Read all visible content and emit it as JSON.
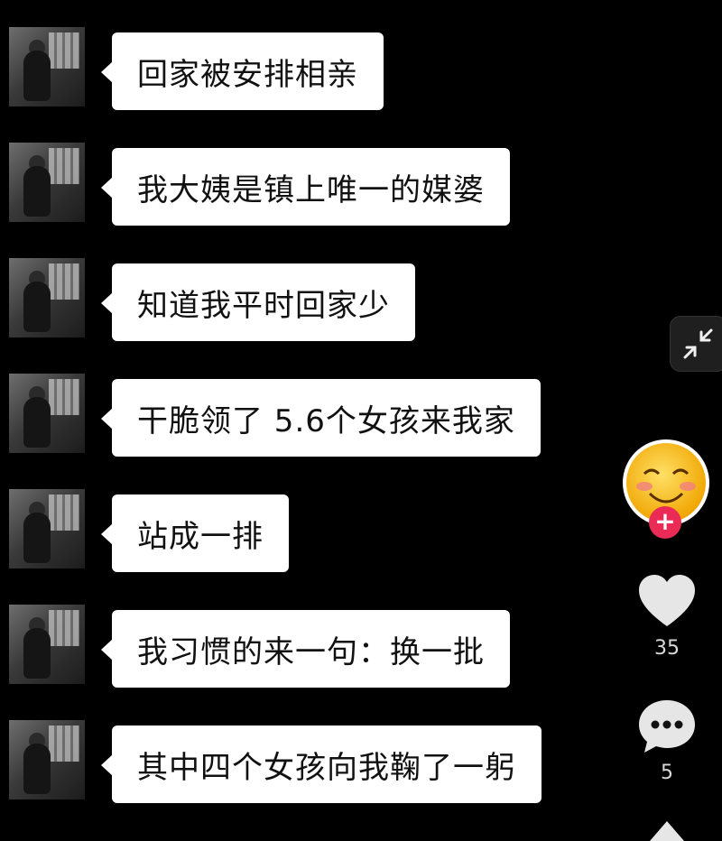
{
  "messages": [
    {
      "text": "回家被安排相亲"
    },
    {
      "text": "我大姨是镇上唯一的媒婆"
    },
    {
      "text": "知道我平时回家少"
    },
    {
      "text": "干脆领了 5.6个女孩来我家"
    },
    {
      "text": "站成一排"
    },
    {
      "text": "我习惯的来一句：换一批"
    },
    {
      "text": "其中四个女孩向我鞠了一躬"
    }
  ],
  "sidebar": {
    "collapse_icon": "collapse-arrows-icon",
    "creator_avatar_icon": "laughing-emoji-icon",
    "follow_icon": "plus-icon",
    "follow_label": "+",
    "like_icon": "heart-icon",
    "like_count": "35",
    "comment_icon": "comment-bubble-icon",
    "comment_count": "5",
    "share_icon": "share-arrow-icon"
  },
  "colors": {
    "background": "#000000",
    "bubble": "#ffffff",
    "follow_button": "#ea2b55",
    "action_icons": "#e6e6e6"
  }
}
